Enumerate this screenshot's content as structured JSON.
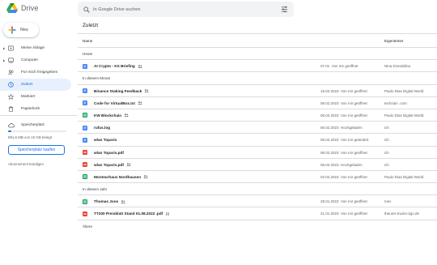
{
  "app": {
    "title": "Drive"
  },
  "search": {
    "placeholder": "In Google Drive suchen"
  },
  "sidebar": {
    "new_label": "Neu",
    "items": [
      {
        "label": "Meine Ablage",
        "icon": "folder-drive-icon",
        "expandable": true
      },
      {
        "label": "Computer",
        "icon": "computer-icon",
        "expandable": true
      },
      {
        "label": "Für mich freigegeben",
        "icon": "people-icon",
        "expandable": false
      },
      {
        "label": "Zuletzt",
        "icon": "clock-icon",
        "expandable": false,
        "active": true
      },
      {
        "label": "Markiert",
        "icon": "star-icon",
        "expandable": false
      },
      {
        "label": "Papierkorb",
        "icon": "trash-icon",
        "expandable": false
      }
    ],
    "storage": {
      "label": "Speicherplatz",
      "used_text": "891,6 MB von 15 GB belegt",
      "used_fraction": 0.059,
      "buy_label": "Speicherplatz kaufen",
      "cancel_label": "Abonnement kündigen"
    }
  },
  "main": {
    "title": "Zuletzt",
    "columns": {
      "name": "Name",
      "owner": "Eigentümer"
    }
  },
  "rows": [
    {
      "type": "section",
      "label": "Heute"
    },
    {
      "type": "file",
      "name": "AI Crypto - KS Briefing",
      "kind": "doc",
      "shared": true,
      "date": "07.01",
      "action": "Von mir geöffnet",
      "owner": "Nina Dzeraldina"
    },
    {
      "type": "section",
      "label": "In diesem Monat"
    },
    {
      "type": "file",
      "name": "Binance Staking Feedback",
      "kind": "doc",
      "shared": true,
      "date": "16.02.2023",
      "action": "Von mir geöffnet",
      "owner": "Paulo Dias Digital World"
    },
    {
      "type": "file",
      "name": "Code for VirtualBox.txt",
      "kind": "doc",
      "shared": true,
      "date": "08.02.2023",
      "action": "Von mir geöffnet",
      "owner": "techzain .com"
    },
    {
      "type": "file",
      "name": "KW Blockchain",
      "kind": "sheet",
      "shared": true,
      "date": "06.02.2023",
      "action": "Von mir geöffnet",
      "owner": "Paulo Dias Digital World"
    },
    {
      "type": "file",
      "name": "rufus.log",
      "kind": "doc",
      "shared": false,
      "date": "06.02.2023",
      "action": "Hochgeladen",
      "owner": "ich"
    },
    {
      "type": "file",
      "name": "wlan Toparis",
      "kind": "doc",
      "shared": false,
      "date": "06.02.2023",
      "action": "Von mir geändert",
      "owner": "ich"
    },
    {
      "type": "file",
      "name": "wlan Toparis.pdf",
      "kind": "pdf",
      "shared": false,
      "date": "06.02.2023",
      "action": "Von mir geöffnet",
      "owner": "ich"
    },
    {
      "type": "file",
      "name": "wlan Toparis.pdf",
      "kind": "pdf",
      "shared": true,
      "date": "06.02.2023",
      "action": "Hochgeladen",
      "owner": "ich"
    },
    {
      "type": "file",
      "name": "Monteurhaus Nordhausen",
      "kind": "sheet",
      "shared": true,
      "date": "02.02.2023",
      "action": "Von mir geöffnet",
      "owner": "Paulo Dias Digital World"
    },
    {
      "type": "section",
      "label": "In diesem Jahr"
    },
    {
      "type": "file",
      "name": "Thomas Joos",
      "kind": "sheet",
      "shared": true,
      "date": "28.01.2023",
      "action": "Von mir geöffnet",
      "owner": "mec"
    },
    {
      "type": "file",
      "name": "TT200 Preisblatt Stand 01.08.2022 .pdf",
      "kind": "pdf",
      "shared": false,
      "doc_badge": true,
      "date": "21.01.2023",
      "action": "Von mir geöffnet",
      "owner": "theurer-trucks-2go.de"
    },
    {
      "type": "section",
      "label": "Ältere"
    }
  ],
  "colors": {
    "active_bg": "#e8f0fe",
    "active_text": "#1967d2",
    "doc": "#4285f4",
    "sheet": "#0f9d58",
    "pdf": "#ea4335",
    "buy_button": "#1a73e8"
  }
}
